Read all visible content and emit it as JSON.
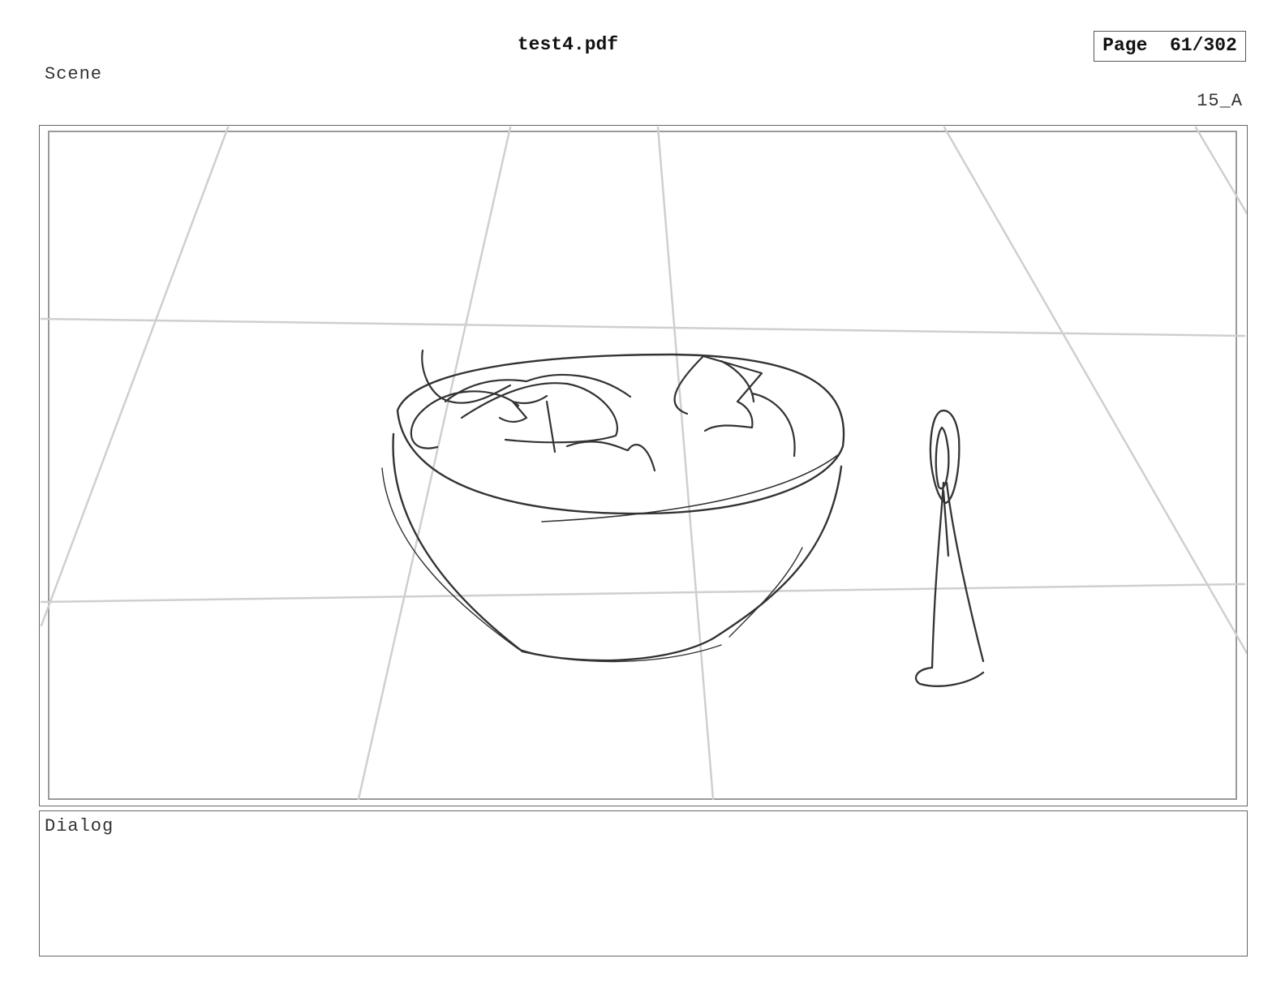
{
  "header": {
    "file_name": "test4.pdf",
    "page_label": "Page",
    "page_number": "61/302"
  },
  "scene": {
    "label": "Scene",
    "shot_id": "15_A"
  },
  "panel": {
    "sketch_subject": "pencil sketch of a bowl of salad with a standing spoon on a tiled floor",
    "grid_color": "#cfcfcf",
    "ink_color": "#333333"
  },
  "dialog": {
    "label": "Dialog",
    "text": ""
  }
}
